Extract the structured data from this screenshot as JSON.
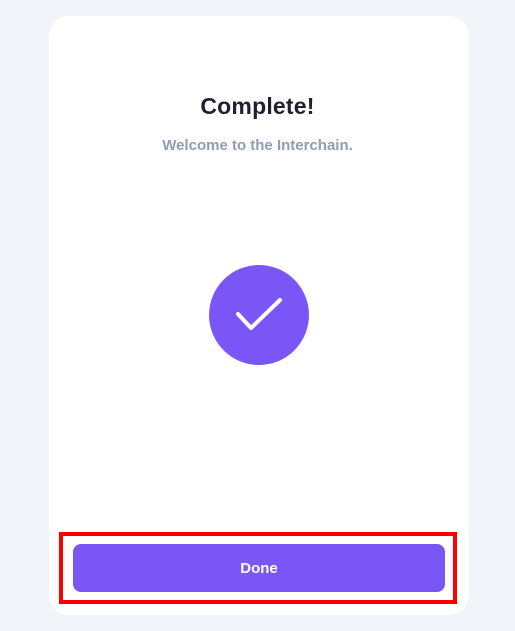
{
  "dialog": {
    "title": "Complete!",
    "subtitle": "Welcome to the Interchain.",
    "status_icon": "checkmark-icon",
    "done_label": "Done"
  },
  "colors": {
    "page_background": "#f1f4f9",
    "card_background": "#ffffff",
    "accent": "#7b56f7",
    "title_text": "#1e2230",
    "subtitle_text": "#8f9bb8",
    "highlight_outline": "#ff0000"
  }
}
